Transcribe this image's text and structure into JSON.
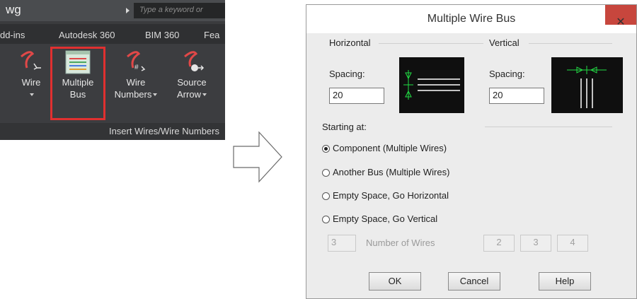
{
  "ribbon": {
    "title": "wg",
    "search_placeholder": "Type a keyword or",
    "tabs": [
      "dd-ins",
      "Autodesk 360",
      "BIM 360",
      "Fea"
    ],
    "buttons": [
      {
        "line1": "Wire",
        "line2": ""
      },
      {
        "line1": "Multiple",
        "line2": "Bus"
      },
      {
        "line1": "Wire",
        "line2": "Numbers"
      },
      {
        "line1": "Source",
        "line2": "Arrow"
      }
    ],
    "panel_label": "Insert Wires/Wire Numbers"
  },
  "dialog": {
    "title": "Multiple Wire Bus",
    "close_glyph": "✕",
    "horizontal": {
      "heading": "Horizontal",
      "spacing_label": "Spacing:",
      "spacing_value": "20"
    },
    "vertical": {
      "heading": "Vertical",
      "spacing_label": "Spacing:",
      "spacing_value": "20"
    },
    "starting_at": "Starting at:",
    "options": [
      {
        "label": "Component (Multiple Wires)",
        "selected": true
      },
      {
        "label": "Another Bus (Multiple Wires)",
        "selected": false
      },
      {
        "label": "Empty Space, Go Horizontal",
        "selected": false
      },
      {
        "label": "Empty Space, Go Vertical",
        "selected": false
      }
    ],
    "wires_value": "3",
    "wires_label": "Number of Wires",
    "wire_presets": [
      "2",
      "3",
      "4"
    ],
    "buttons": {
      "ok": "OK",
      "cancel": "Cancel",
      "help": "Help"
    }
  },
  "colors": {
    "highlight": "#e03030",
    "close_button": "#c7463d",
    "preview_bg": "#0f0f0f",
    "preview_green": "#22dd44"
  }
}
